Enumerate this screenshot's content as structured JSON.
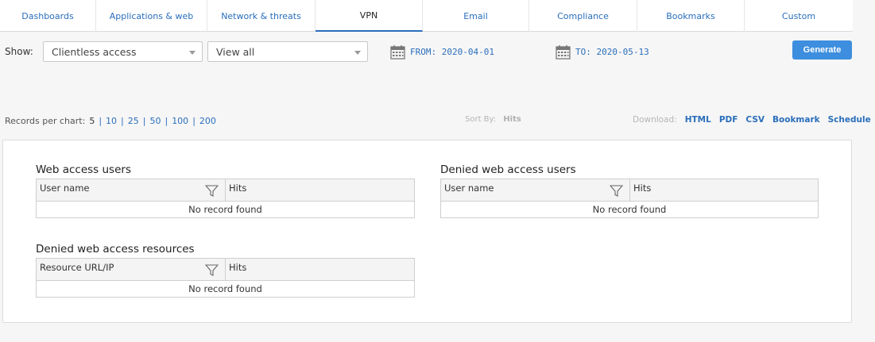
{
  "tabs": [
    {
      "label": "Dashboards",
      "active": false
    },
    {
      "label": "Applications & web",
      "active": false
    },
    {
      "label": "Network & threats",
      "active": false
    },
    {
      "label": "VPN",
      "active": true
    },
    {
      "label": "Email",
      "active": false
    },
    {
      "label": "Compliance",
      "active": false
    },
    {
      "label": "Bookmarks",
      "active": false
    },
    {
      "label": "Custom",
      "active": false
    }
  ],
  "filters": {
    "show_label": "Show:",
    "report_select": "Clientless access",
    "view_select": "View all",
    "from": "FROM: 2020-04-01",
    "to": "TO: 2020-05-13",
    "generate_label": "Generate"
  },
  "records": {
    "label": "Records per chart:",
    "options": [
      "5",
      "10",
      "25",
      "50",
      "100",
      "200"
    ],
    "separator": "|"
  },
  "sort": {
    "label": "Sort By:",
    "value": "Hits"
  },
  "download": {
    "label": "Download:",
    "links": [
      "HTML",
      "PDF",
      "CSV",
      "Bookmark",
      "Schedule"
    ]
  },
  "tables": [
    {
      "title": "Web access users",
      "col1": "User name",
      "col2": "Hits",
      "empty": "No record found"
    },
    {
      "title": "Denied web access users",
      "col1": "User name",
      "col2": "Hits",
      "empty": "No record found"
    },
    {
      "title": "Denied web access resources",
      "col1": "Resource URL/IP",
      "col2": "Hits",
      "empty": "No record found"
    }
  ],
  "icons": {
    "calendar": "calendar-icon",
    "filter": "funnel-filter-icon",
    "dropdown": "chevron-down-icon"
  },
  "colors": {
    "accent": "#2a6ebb",
    "button": "#3d8ede"
  }
}
